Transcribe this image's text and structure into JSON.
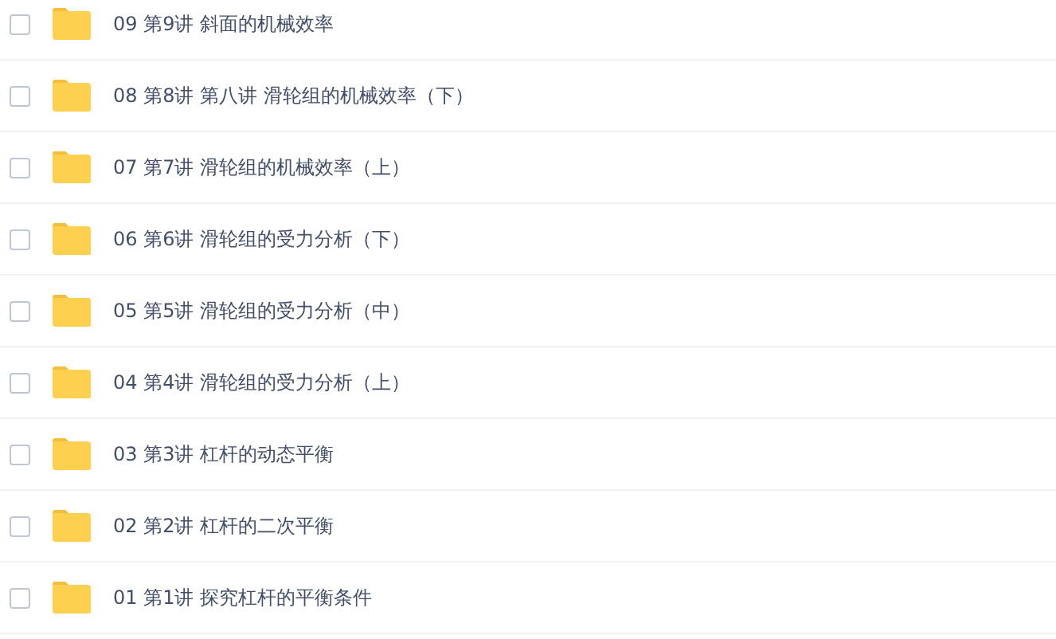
{
  "files": [
    {
      "name": "09 第9讲 斜面的机械效率",
      "checked": false
    },
    {
      "name": "08 第8讲 第八讲 滑轮组的机械效率（下）",
      "checked": false
    },
    {
      "name": "07 第7讲 滑轮组的机械效率（上）",
      "checked": false
    },
    {
      "name": "06 第6讲 滑轮组的受力分析（下）",
      "checked": false
    },
    {
      "name": "05 第5讲 滑轮组的受力分析（中）",
      "checked": false
    },
    {
      "name": "04 第4讲 滑轮组的受力分析（上）",
      "checked": false
    },
    {
      "name": "03 第3讲 杠杆的动态平衡",
      "checked": false
    },
    {
      "name": "02 第2讲 杠杆的二次平衡",
      "checked": false
    },
    {
      "name": "01 第1讲 探究杠杆的平衡条件",
      "checked": false
    }
  ]
}
